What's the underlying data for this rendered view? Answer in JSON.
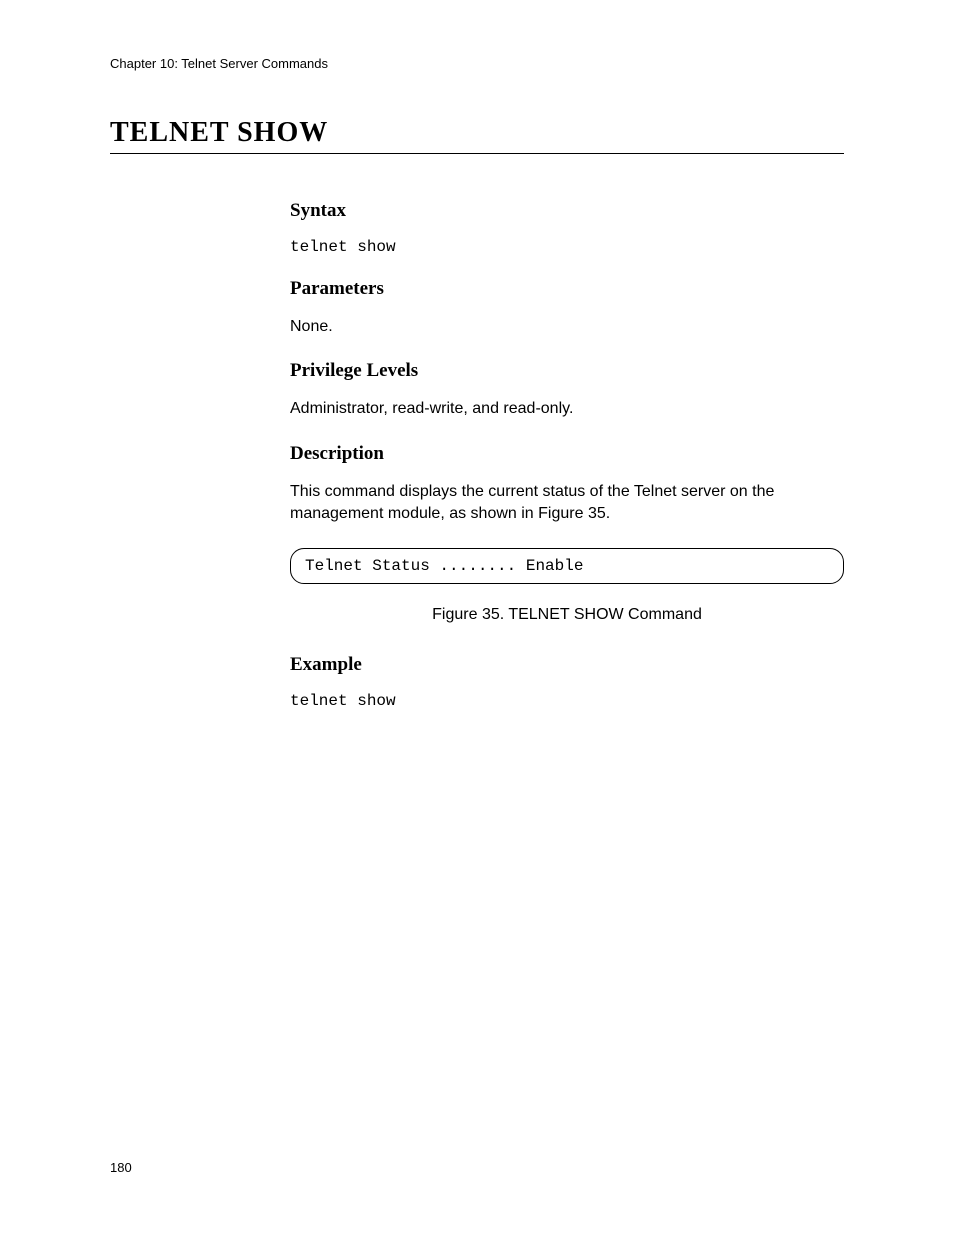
{
  "header": {
    "chapter": "Chapter 10: Telnet Server Commands"
  },
  "title": "TELNET SHOW",
  "sections": {
    "syntax": {
      "heading": "Syntax",
      "code": "telnet show"
    },
    "parameters": {
      "heading": "Parameters",
      "text": "None."
    },
    "privilege": {
      "heading": "Privilege Levels",
      "text": "Administrator, read-write, and read-only."
    },
    "description": {
      "heading": "Description",
      "text": "This command displays the current status of the Telnet server on the management module, as shown in Figure 35.",
      "output": "Telnet Status ........ Enable",
      "caption": "Figure 35. TELNET SHOW Command"
    },
    "example": {
      "heading": "Example",
      "code": "telnet show"
    }
  },
  "footer": {
    "page_number": "180"
  }
}
